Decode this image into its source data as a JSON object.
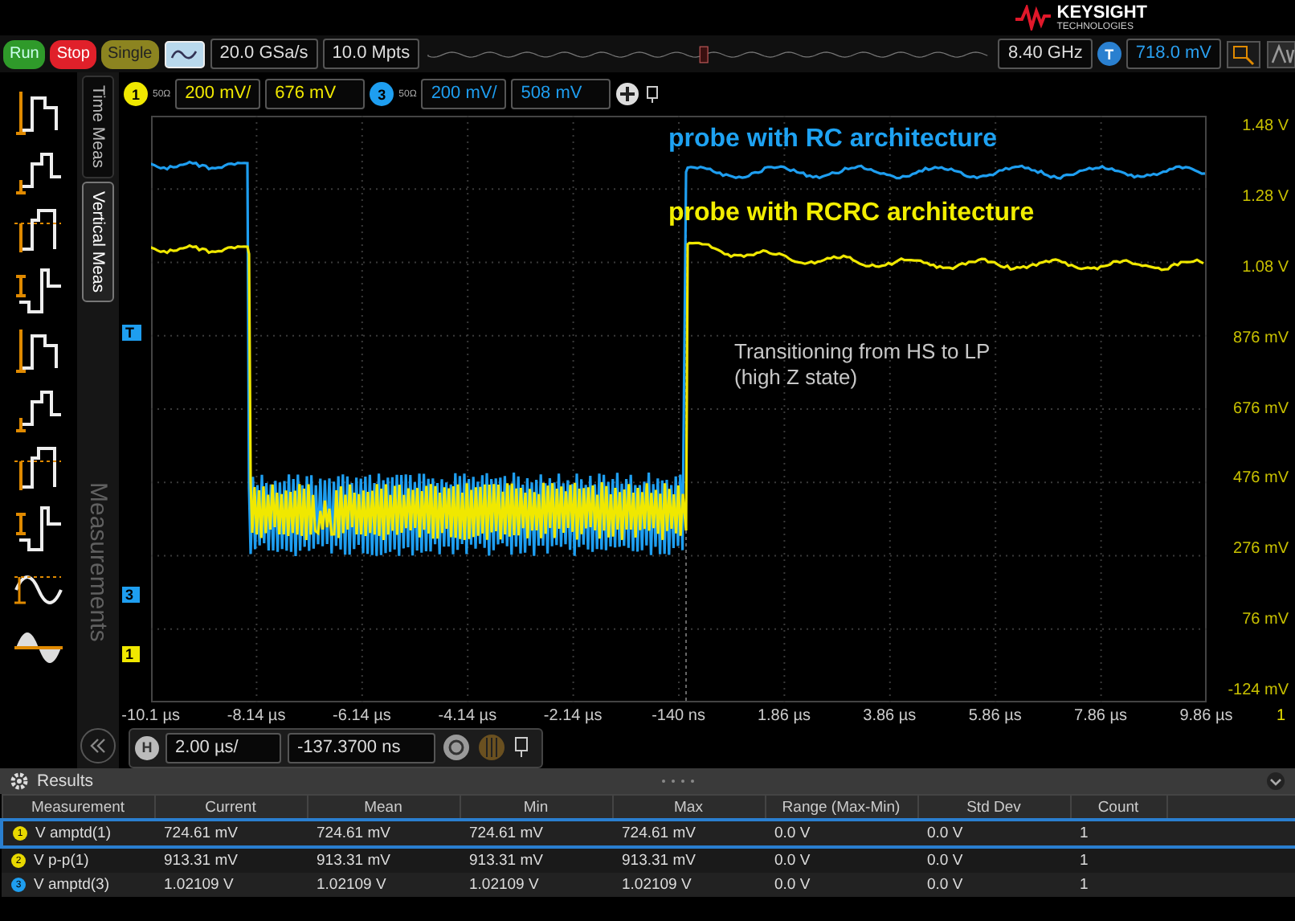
{
  "brand": {
    "name": "KEYSIGHT",
    "tagline": "TECHNOLOGIES"
  },
  "toolbar": {
    "buttons": [
      {
        "label": "Run",
        "kind": "run"
      },
      {
        "label": "Stop",
        "kind": "stop"
      },
      {
        "label": "Single",
        "kind": "single"
      }
    ],
    "sample_rate": "20.0 GSa/s",
    "memory_depth": "10.0 Mpts",
    "bandwidth": "8.40 GHz",
    "trigger_badge": "T",
    "trigger_level": "718.0 mV"
  },
  "channels": [
    {
      "number": "1",
      "impedance": "50Ω",
      "scale": "200 mV/",
      "offset": "676 mV",
      "color": "#f0e800"
    },
    {
      "number": "3",
      "impedance": "50Ω",
      "scale": "200 mV/",
      "offset": "508 mV",
      "color": "#1e9ef0"
    }
  ],
  "side_tabs": [
    {
      "label": "Time Meas",
      "selected": false
    },
    {
      "label": "Vertical Meas",
      "selected": true
    }
  ],
  "panel_title": "Measurements",
  "plot": {
    "annotations": [
      {
        "kind": "label",
        "text": "probe with RC architecture",
        "color": "#1ea2f2"
      },
      {
        "kind": "label",
        "text": "probe with RCRC architecture",
        "color": "#f2ee00"
      },
      {
        "kind": "note",
        "text": "Transitioning from HS to LP (high Z state)"
      }
    ],
    "markers": [
      {
        "text": "T",
        "color": "#1e9ef0"
      },
      {
        "text": "3",
        "color": "#1e9ef0"
      },
      {
        "text": "1",
        "color": "#f0e800"
      }
    ],
    "y_labels": [
      "1.48 V",
      "1.28 V",
      "1.08 V",
      "876 mV",
      "676 mV",
      "476 mV",
      "276 mV",
      "76 mV",
      "-124 mV"
    ],
    "x_labels": [
      "-10.1 µs",
      "-8.14 µs",
      "-6.14 µs",
      "-4.14 µs",
      "-2.14 µs",
      "-140 ns",
      "1.86 µs",
      "3.86 µs",
      "5.86 µs",
      "7.86 µs",
      "9.86 µs"
    ],
    "x_end_label": "1"
  },
  "horizontal": {
    "badge": "H",
    "scale": "2.00 µs/",
    "delay": "-137.3700 ns"
  },
  "results": {
    "title": "Results",
    "columns": [
      "Measurement",
      "Current",
      "Mean",
      "Min",
      "Max",
      "Range (Max-Min)",
      "Std Dev",
      "Count"
    ],
    "rows": [
      {
        "selected": true,
        "channel": "1",
        "color": "#e8d800",
        "cells": [
          "V amptd(1)",
          "724.61 mV",
          "724.61 mV",
          "724.61 mV",
          "724.61 mV",
          "0.0 V",
          "0.0 V",
          "1"
        ]
      },
      {
        "selected": false,
        "channel": "2",
        "color": "#e8d800",
        "cells": [
          "V p-p(1)",
          "913.31 mV",
          "913.31 mV",
          "913.31 mV",
          "913.31 mV",
          "0.0 V",
          "0.0 V",
          "1"
        ]
      },
      {
        "selected": false,
        "channel": "3",
        "color": "#1e9ef0",
        "cells": [
          "V amptd(3)",
          "1.02109 V",
          "1.02109 V",
          "1.02109 V",
          "1.02109 V",
          "0.0 V",
          "0.0 V",
          "1"
        ]
      }
    ]
  }
}
